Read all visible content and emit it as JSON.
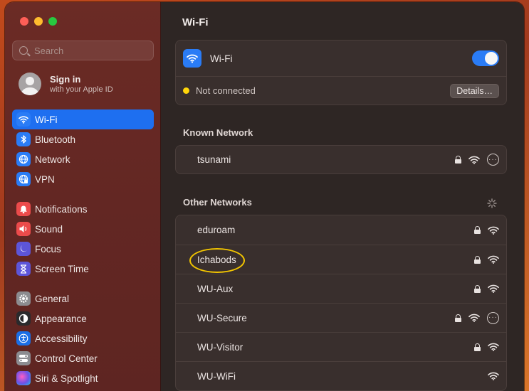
{
  "window": {
    "title": "Wi-Fi"
  },
  "sidebar": {
    "search_placeholder": "Search",
    "account": {
      "name": "Sign in",
      "sub": "with your Apple ID"
    },
    "groups": [
      [
        {
          "label": "Wi-Fi",
          "icon": "wifi-icon",
          "active": true
        },
        {
          "label": "Bluetooth",
          "icon": "bluetooth-icon"
        },
        {
          "label": "Network",
          "icon": "globe-icon"
        },
        {
          "label": "VPN",
          "icon": "vpn-icon"
        }
      ],
      [
        {
          "label": "Notifications",
          "icon": "bell-icon"
        },
        {
          "label": "Sound",
          "icon": "speaker-icon"
        },
        {
          "label": "Focus",
          "icon": "moon-icon"
        },
        {
          "label": "Screen Time",
          "icon": "hourglass-icon"
        }
      ],
      [
        {
          "label": "General",
          "icon": "gear-icon"
        },
        {
          "label": "Appearance",
          "icon": "appearance-icon"
        },
        {
          "label": "Accessibility",
          "icon": "accessibility-icon"
        },
        {
          "label": "Control Center",
          "icon": "control-center-icon"
        },
        {
          "label": "Siri & Spotlight",
          "icon": "siri-icon"
        }
      ]
    ]
  },
  "wifi": {
    "label": "Wi-Fi",
    "enabled": true,
    "status": "Not connected",
    "details_button": "Details…"
  },
  "known_network": {
    "title": "Known Network",
    "networks": [
      {
        "name": "tsunami",
        "locked": true,
        "more": true
      }
    ]
  },
  "other_networks": {
    "title": "Other Networks",
    "networks": [
      {
        "name": "eduroam",
        "locked": true,
        "more": false
      },
      {
        "name": "Ichabods",
        "locked": true,
        "more": false
      },
      {
        "name": "WU-Aux",
        "locked": true,
        "more": false
      },
      {
        "name": "WU-Secure",
        "locked": true,
        "more": true
      },
      {
        "name": "WU-Visitor",
        "locked": true,
        "more": false
      },
      {
        "name": "WU-WiFi",
        "locked": false,
        "more": false
      }
    ]
  },
  "colors": {
    "accent": "#1e6ff0",
    "highlight_circle": "#f2c500",
    "status_dot": "#ffd60a"
  }
}
